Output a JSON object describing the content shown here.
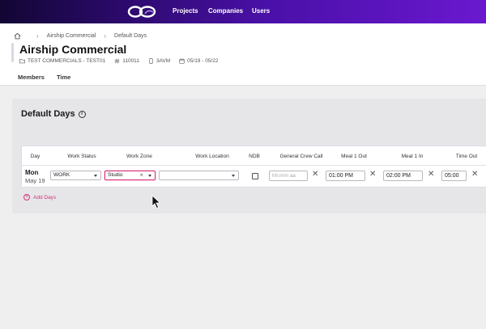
{
  "nav": {
    "items": [
      "Projects",
      "Companies",
      "Users"
    ]
  },
  "breadcrumb": {
    "items": [
      "Airship Commercial",
      "Default Days"
    ]
  },
  "project": {
    "title": "Airship Commercial",
    "meta": {
      "folder": "TEST COMMERCIALS - TEST01",
      "number": "110011",
      "code": "3AVM",
      "dates": "05/19 - 05/22"
    }
  },
  "tabs": [
    "Members",
    "Time"
  ],
  "section": {
    "title": "Default Days",
    "info_icon": "i"
  },
  "table": {
    "headers": [
      "Day",
      "Work Status",
      "Work Zone",
      "Work Location",
      "NDB",
      "General Crew Call",
      "Meal 1 Out",
      "Meal 1 In",
      "Time Out"
    ],
    "row": {
      "day": "Mon",
      "date": "May 19",
      "work_status": "WORK",
      "work_zone": "Studio",
      "work_location": "",
      "ndb_checked": false,
      "crew_call_placeholder": "hh:mm aa",
      "meal1_out": "01:00 PM",
      "meal1_in": "02:00 PM",
      "time_out": "05:00"
    }
  },
  "add_days_label": "Add Days",
  "colors": {
    "accent": "#d6337a",
    "nav_start": "#120634",
    "nav_end": "#6a18cf"
  },
  "icons": [
    "app-logo",
    "home-icon",
    "folder-icon",
    "hash-icon",
    "phone-icon",
    "calendar-icon",
    "info-icon",
    "chevron-down-icon",
    "clear-icon",
    "close-icon",
    "plus-circle-icon",
    "mouse-cursor"
  ]
}
